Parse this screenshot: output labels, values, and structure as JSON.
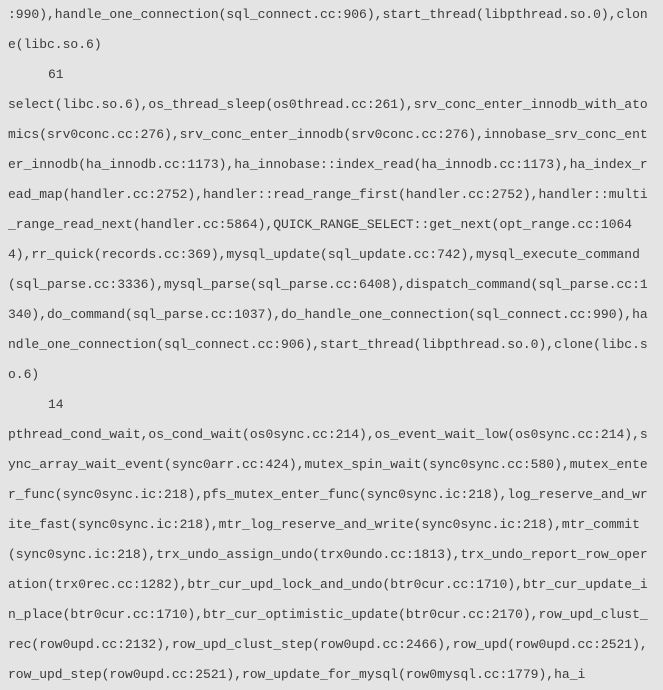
{
  "blocks": {
    "b1": {
      "trace": ":990),handle_one_connection(sql_connect.cc:906),start_thread(libpthread.so.0),clone(libc.so.6)"
    },
    "b2": {
      "count": "61",
      "trace": "select(libc.so.6),os_thread_sleep(os0thread.cc:261),srv_conc_enter_innodb_with_atomics(srv0conc.cc:276),srv_conc_enter_innodb(srv0conc.cc:276),innobase_srv_conc_enter_innodb(ha_innodb.cc:1173),ha_innobase::index_read(ha_innodb.cc:1173),ha_index_read_map(handler.cc:2752),handler::read_range_first(handler.cc:2752),handler::multi_range_read_next(handler.cc:5864),QUICK_RANGE_SELECT::get_next(opt_range.cc:10644),rr_quick(records.cc:369),mysql_update(sql_update.cc:742),mysql_execute_command(sql_parse.cc:3336),mysql_parse(sql_parse.cc:6408),dispatch_command(sql_parse.cc:1340),do_command(sql_parse.cc:1037),do_handle_one_connection(sql_connect.cc:990),handle_one_connection(sql_connect.cc:906),start_thread(libpthread.so.0),clone(libc.so.6)"
    },
    "b3": {
      "count": "14",
      "trace": "pthread_cond_wait,os_cond_wait(os0sync.cc:214),os_event_wait_low(os0sync.cc:214),sync_array_wait_event(sync0arr.cc:424),mutex_spin_wait(sync0sync.cc:580),mutex_enter_func(sync0sync.ic:218),pfs_mutex_enter_func(sync0sync.ic:218),log_reserve_and_write_fast(sync0sync.ic:218),mtr_log_reserve_and_write(sync0sync.ic:218),mtr_commit(sync0sync.ic:218),trx_undo_assign_undo(trx0undo.cc:1813),trx_undo_report_row_operation(trx0rec.cc:1282),btr_cur_upd_lock_and_undo(btr0cur.cc:1710),btr_cur_update_in_place(btr0cur.cc:1710),btr_cur_optimistic_update(btr0cur.cc:2170),row_upd_clust_rec(row0upd.cc:2132),row_upd_clust_step(row0upd.cc:2466),row_upd(row0upd.cc:2521),row_upd_step(row0upd.cc:2521),row_update_for_mysql(row0mysql.cc:1779),ha_i"
    }
  }
}
